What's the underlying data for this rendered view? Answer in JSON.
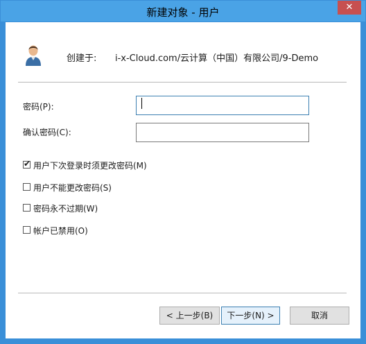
{
  "window": {
    "title": "新建对象 - 用户",
    "close_glyph": "✕"
  },
  "header": {
    "created_label": "创建于:",
    "created_path": "i-x-Cloud.com/云计算（中国）有限公司/9-Demo"
  },
  "form": {
    "password_label": "密码(P):",
    "password_value": "",
    "confirm_label": "确认密码(C):",
    "confirm_value": ""
  },
  "options": [
    {
      "label": "用户下次登录时须更改密码(M)",
      "checked": true
    },
    {
      "label": "用户不能更改密码(S)",
      "checked": false
    },
    {
      "label": "密码永不过期(W)",
      "checked": false
    },
    {
      "label": "帐户已禁用(O)",
      "checked": false
    }
  ],
  "buttons": {
    "back": "< 上一步(B)",
    "next": "下一步(N) >",
    "cancel": "取消"
  },
  "icons": {
    "user": "user-icon",
    "check": "✔"
  }
}
